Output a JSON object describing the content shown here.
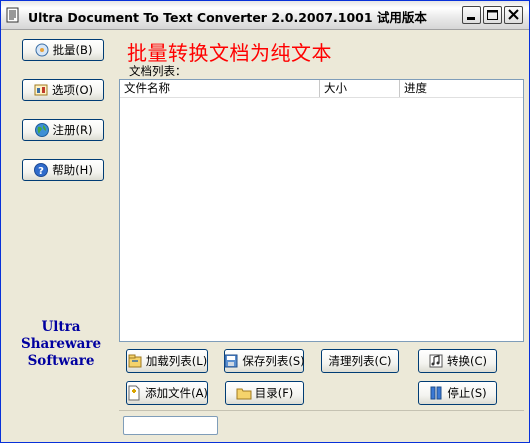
{
  "window": {
    "title": "Ultra Document To Text Converter 2.0.2007.1001 试用版本"
  },
  "sidebar": {
    "buttons": [
      {
        "label": "批量(B)",
        "icon": "batch-icon"
      },
      {
        "label": "选项(O)",
        "icon": "options-icon"
      },
      {
        "label": "注册(R)",
        "icon": "register-globe-icon"
      },
      {
        "label": "帮助(H)",
        "icon": "help-icon"
      }
    ],
    "brand_lines": [
      "Ultra",
      "Shareware",
      "Software"
    ]
  },
  "main": {
    "heading": "批量转换文档为纯文本",
    "list_caption": "文档列表：",
    "columns": [
      "文件名称",
      "大小",
      "进度"
    ],
    "rows": []
  },
  "actions": {
    "add_list": "加载列表(L)",
    "save_list": "保存列表(S)",
    "clear_list": "清理列表(C)",
    "convert": "转换(C)",
    "add_file": "添加文件(A)",
    "directory": "目录(F)",
    "stop": "停止(S)"
  },
  "status": {
    "field_value": ""
  },
  "colors": {
    "heading": "#ff0000",
    "brand": "#0000a0",
    "window_bg": "#ece9d8"
  }
}
